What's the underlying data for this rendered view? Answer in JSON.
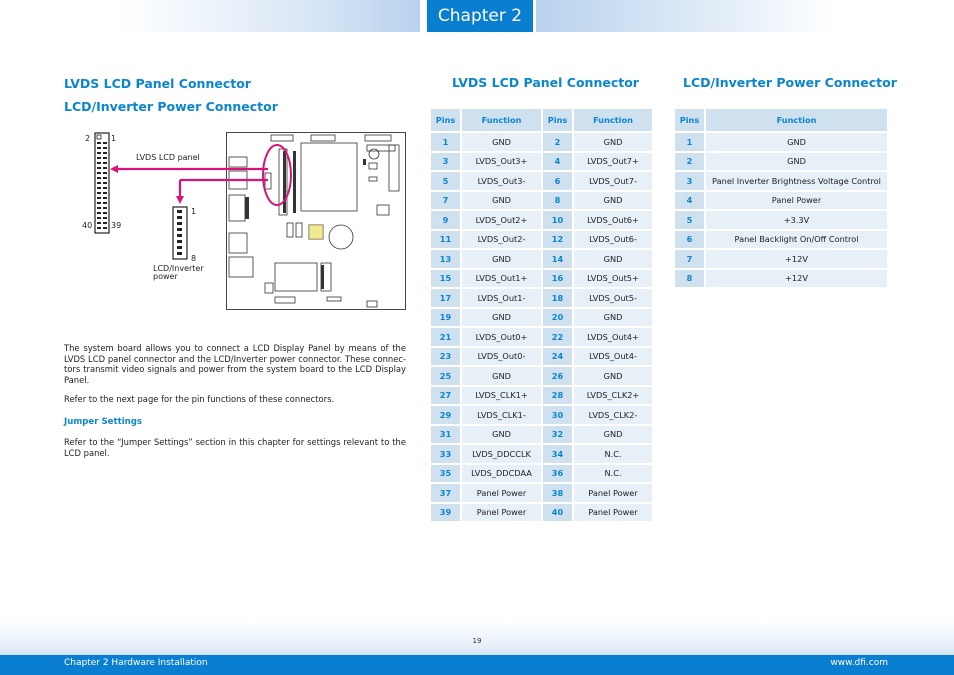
{
  "header": {
    "chapter_label": "Chapter 2"
  },
  "left": {
    "title1": "LVDS LCD Panel Connector",
    "title2": "LCD/Inverter Power Connector",
    "diagram": {
      "pin_2": "2",
      "pin_1": "1",
      "pin_40": "40",
      "pin_39": "39",
      "pin_inv_1": "1",
      "pin_inv_8": "8",
      "lvds_label": "LVDS LCD panel",
      "inverter_label_line1": "LCD/Inverter",
      "inverter_label_line2": "power"
    },
    "paragraph1": "The system board allows you to connect a LCD Display Panel by means of the LVDS LCD panel connector and the LCD/Inverter power connector. These connec-tors transmit video signals and power from the system board to the LCD Display Panel.",
    "paragraph2": "Refer to the next page for the pin functions of these connectors.",
    "jumper_heading": "Jumper Settings",
    "paragraph3": "Refer to the “Jumper Settings” section in this chapter for settings relevant to the LCD panel."
  },
  "lvds_table": {
    "title": "LVDS LCD Panel Connector",
    "headers": [
      "Pins",
      "Function",
      "Pins",
      "Function"
    ],
    "rows": [
      [
        "1",
        "GND",
        "2",
        "GND"
      ],
      [
        "3",
        "LVDS_Out3+",
        "4",
        "LVDS_Out7+"
      ],
      [
        "5",
        "LVDS_Out3-",
        "6",
        "LVDS_Out7-"
      ],
      [
        "7",
        "GND",
        "8",
        "GND"
      ],
      [
        "9",
        "LVDS_Out2+",
        "10",
        "LVDS_Out6+"
      ],
      [
        "11",
        "LVDS_Out2-",
        "12",
        "LVDS_Out6-"
      ],
      [
        "13",
        "GND",
        "14",
        "GND"
      ],
      [
        "15",
        "LVDS_Out1+",
        "16",
        "LVDS_Out5+"
      ],
      [
        "17",
        "LVDS_Out1-",
        "18",
        "LVDS_Out5-"
      ],
      [
        "19",
        "GND",
        "20",
        "GND"
      ],
      [
        "21",
        "LVDS_Out0+",
        "22",
        "LVDS_Out4+"
      ],
      [
        "23",
        "LVDS_Out0-",
        "24",
        "LVDS_Out4-"
      ],
      [
        "25",
        "GND",
        "26",
        "GND"
      ],
      [
        "27",
        "LVDS_CLK1+",
        "28",
        "LVDS_CLK2+"
      ],
      [
        "29",
        "LVDS_CLK1-",
        "30",
        "LVDS_CLK2-"
      ],
      [
        "31",
        "GND",
        "32",
        "GND"
      ],
      [
        "33",
        "LVDS_DDCCLK",
        "34",
        "N.C."
      ],
      [
        "35",
        "LVDS_DDCDAA",
        "36",
        "N.C."
      ],
      [
        "37",
        "Panel Power",
        "38",
        "Panel Power"
      ],
      [
        "39",
        "Panel Power",
        "40",
        "Panel Power"
      ]
    ]
  },
  "power_table": {
    "title": "LCD/Inverter Power Connector",
    "headers": [
      "Pins",
      "Function"
    ],
    "rows": [
      [
        "1",
        "GND"
      ],
      [
        "2",
        "GND"
      ],
      [
        "3",
        "Panel Inverter Brightness Voltage Control"
      ],
      [
        "4",
        "Panel Power"
      ],
      [
        "5",
        "+3.3V"
      ],
      [
        "6",
        "Panel Backlight On/Off Control"
      ],
      [
        "7",
        "+12V"
      ],
      [
        "8",
        "+12V"
      ]
    ]
  },
  "footer": {
    "page_number": "19",
    "left_text": "Chapter 2 Hardware Installation",
    "right_text": "www.dfi.com"
  },
  "colors": {
    "accent": "#0a7fd1",
    "heading": "#0a86cf",
    "table_head": "#cfe0ef",
    "table_cell": "#e7eff7",
    "callout": "#d8137a"
  }
}
